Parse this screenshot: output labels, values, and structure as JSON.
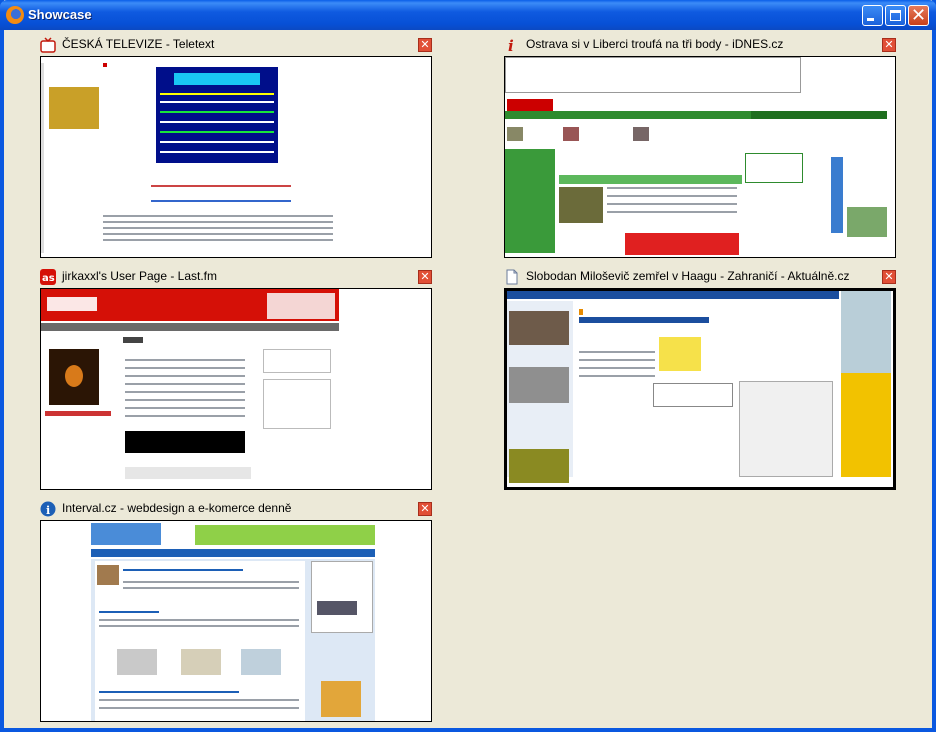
{
  "window": {
    "title": "Showcase",
    "buttons": [
      "minimize-button",
      "maximize-button",
      "close-button"
    ]
  },
  "panes": [
    {
      "title": "ČESKÁ TELEVIZE - Teletext",
      "icon": "tv-icon"
    },
    {
      "title": "Ostrava si v Liberci troufá na tři body - iDNES.cz",
      "icon": "info-i-icon"
    },
    {
      "title": "jirkaxxl's User Page - Last.fm",
      "icon": "lastfm-icon"
    },
    {
      "title": "Slobodan Miloševič zemřel v Haagu - Zahraničí - Aktuálně.cz",
      "icon": "document-icon"
    },
    {
      "title": "Interval.cz - webdesign a e-komerce denně",
      "icon": "info-circle-icon"
    }
  ],
  "colors": {
    "titlebar": "#0A58E0",
    "close": "#E14F36",
    "idnes": "#2E8B2E",
    "lastfm": "#D51007",
    "aktualne": "#1B4E9E",
    "interval": "#1C5FB6"
  }
}
